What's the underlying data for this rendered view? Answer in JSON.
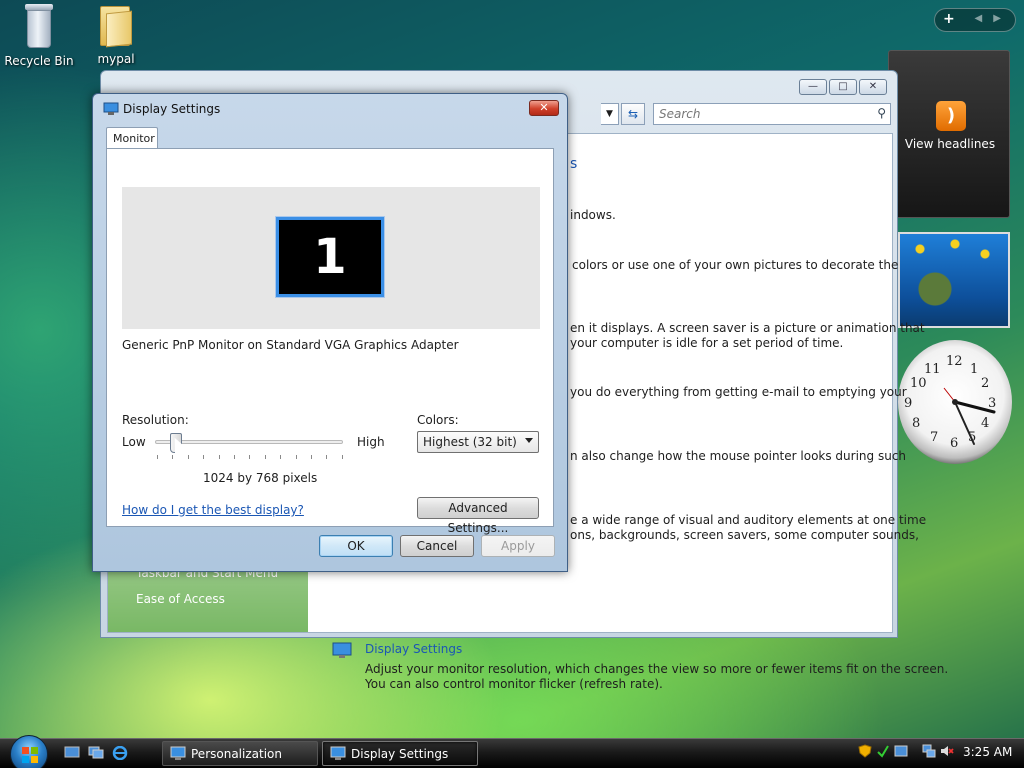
{
  "desktop": {
    "icons": [
      {
        "label": "Recycle Bin",
        "icon": "recycle-bin-icon"
      },
      {
        "label": "mypal",
        "icon": "folder-icon"
      }
    ]
  },
  "sidebar": {
    "feed_label": "View headlines",
    "clock_numbers": [
      "12",
      "1",
      "2",
      "3",
      "4",
      "5",
      "6",
      "7",
      "8",
      "9",
      "10",
      "11"
    ]
  },
  "personalization_window": {
    "search_placeholder": "Search",
    "heading_partial": "s",
    "lines": [
      "indows.",
      "colors or use one of your own pictures to decorate the",
      "en it displays. A screen saver is a picture or animation that",
      "your computer is idle for a set period of time.",
      "you do everything from getting e-mail to emptying your",
      "n also change how the mouse pointer looks during such",
      "e a wide range of visual and auditory elements at one time",
      "ons, backgrounds, screen savers, some computer sounds,"
    ],
    "left_links": [
      "Taskbar and Start Menu",
      "Ease of Access"
    ],
    "display_settings_link": "Display Settings",
    "display_settings_desc": [
      "Adjust your monitor resolution, which changes the view so more or fewer items fit on the screen.",
      "You can also control monitor flicker (refresh rate)."
    ]
  },
  "dialog": {
    "title": "Display Settings",
    "close_label": "✕",
    "tab_monitor": "Monitor",
    "monitor_number": "1",
    "monitor_name": "Generic PnP Monitor on Standard VGA Graphics Adapter",
    "resolution_label": "Resolution:",
    "low_label": "Low",
    "high_label": "High",
    "resolution_value": "1024 by 768 pixels",
    "colors_label": "Colors:",
    "colors_value": "Highest (32 bit)",
    "help_link": "How do I get the best display?",
    "advanced_button": "Advanced Settings...",
    "ok_button": "OK",
    "cancel_button": "Cancel",
    "apply_button": "Apply"
  },
  "taskbar": {
    "tasks": [
      {
        "label": "Personalization",
        "active": false
      },
      {
        "label": "Display Settings",
        "active": true
      }
    ],
    "time": "3:25 AM"
  },
  "colors": {
    "link_blue": "#1b57b4",
    "monitor_border": "#3b8fe6",
    "close_red": "#d0402a"
  }
}
